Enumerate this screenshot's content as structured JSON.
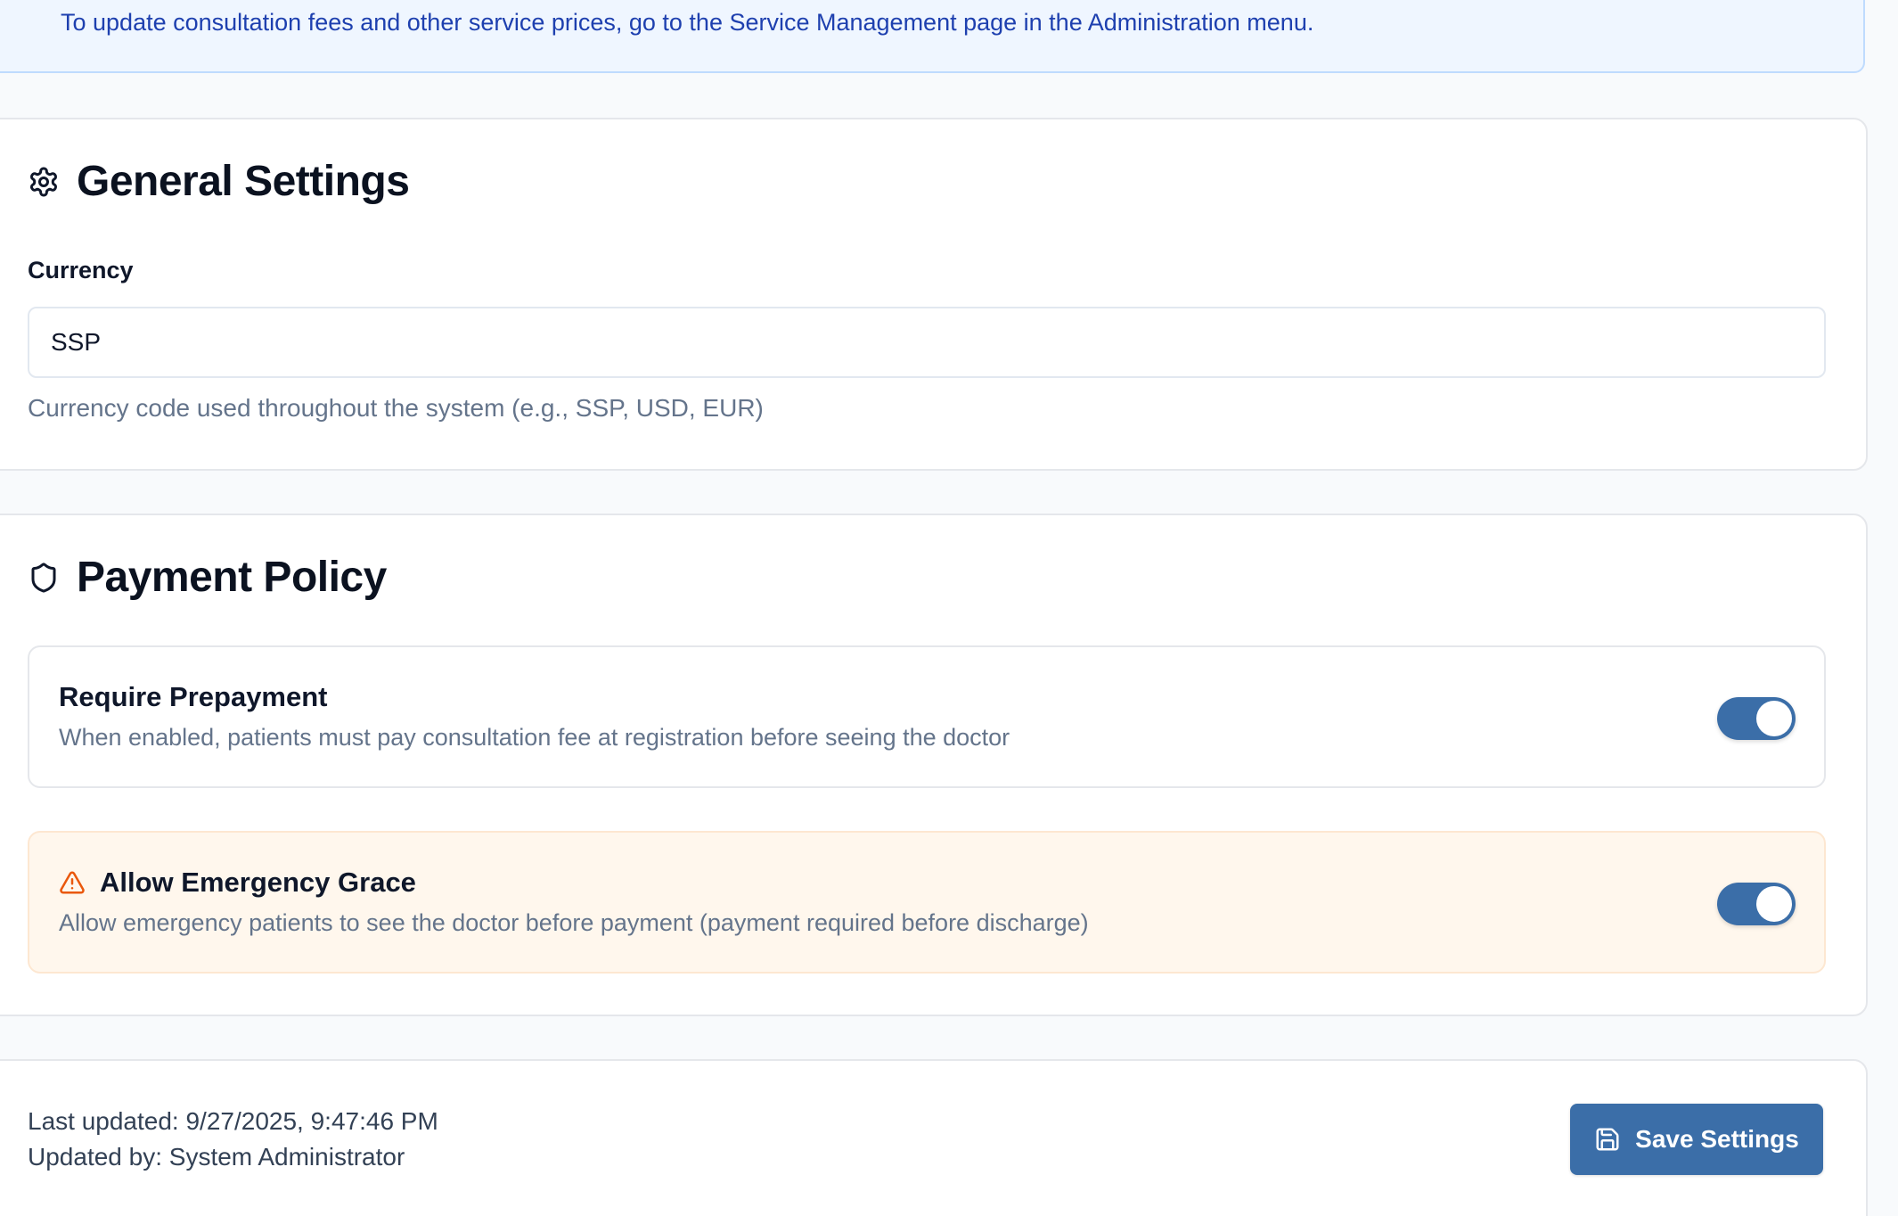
{
  "banner": {
    "text": "To update consultation fees and other service prices, go to the Service Management page in the Administration menu."
  },
  "general": {
    "title": "General Settings",
    "icon": "gear-icon",
    "currency_label": "Currency",
    "currency_value": "SSP",
    "currency_help": "Currency code used throughout the system (e.g., SSP, USD, EUR)"
  },
  "payment": {
    "title": "Payment Policy",
    "icon": "shield-icon",
    "require_prepayment": {
      "title": "Require Prepayment",
      "description": "When enabled, patients must pay consultation fee at registration before seeing the doctor",
      "enabled": true
    },
    "emergency_grace": {
      "title": "Allow Emergency Grace",
      "icon": "warning-icon",
      "description": "Allow emergency patients to see the doctor before payment (payment required before discharge)",
      "enabled": true
    }
  },
  "footer": {
    "last_updated": "Last updated: 9/27/2025, 9:47:46 PM",
    "updated_by": "Updated by: System Administrator",
    "save_label": "Save Settings",
    "save_icon": "save-icon"
  },
  "colors": {
    "accent": "#3b6ea8",
    "banner_bg": "#eff6ff",
    "banner_text": "#1e40af",
    "warning": "#ea580c",
    "warning_bg": "#fff7ed"
  }
}
